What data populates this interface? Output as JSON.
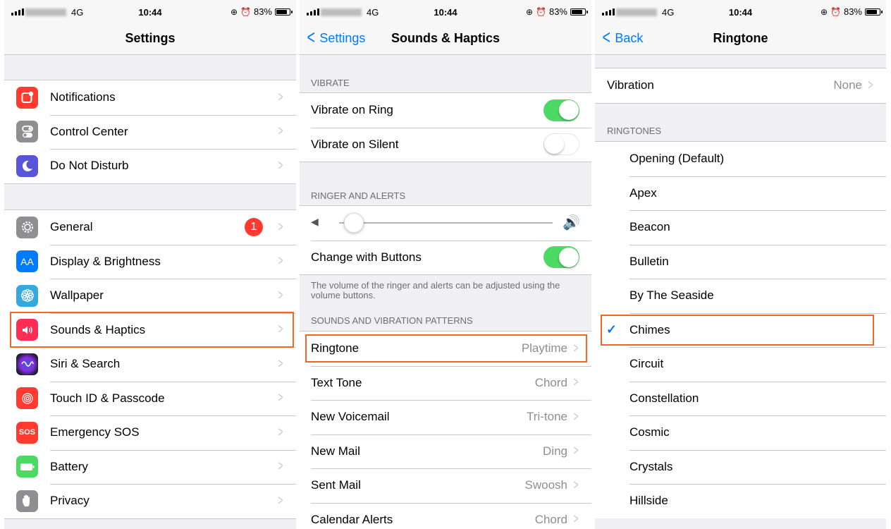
{
  "status": {
    "network": "4G",
    "time": "10:44",
    "battery": "83%",
    "rotation_icon": "rotation-lock-icon",
    "alarm_icon": "alarm-clock-icon"
  },
  "screen1": {
    "title": "Settings",
    "group1": [
      {
        "label": "Notifications",
        "icon": "notifications-icon",
        "color": "#ff3b30"
      },
      {
        "label": "Control Center",
        "icon": "control-center-icon",
        "color": "#8e8e93"
      },
      {
        "label": "Do Not Disturb",
        "icon": "moon-icon",
        "color": "#5856d6"
      }
    ],
    "group2": [
      {
        "label": "General",
        "icon": "gear-icon",
        "color": "#8e8e93",
        "badge": "1"
      },
      {
        "label": "Display & Brightness",
        "icon": "display-icon",
        "color": "#007aff",
        "glyph": "AA"
      },
      {
        "label": "Wallpaper",
        "icon": "wallpaper-icon",
        "color": "#34aadc"
      },
      {
        "label": "Sounds & Haptics",
        "icon": "speaker-icon",
        "color": "#ff2d55"
      },
      {
        "label": "Siri & Search",
        "icon": "siri-icon",
        "color": "#1f1f3a"
      },
      {
        "label": "Touch ID & Passcode",
        "icon": "fingerprint-icon",
        "color": "#ff3b30"
      },
      {
        "label": "Emergency SOS",
        "icon": "sos-icon",
        "color": "#ff3b30",
        "glyph": "SOS"
      },
      {
        "label": "Battery",
        "icon": "battery-icon",
        "color": "#4cd964"
      },
      {
        "label": "Privacy",
        "icon": "hand-icon",
        "color": "#8e8e93"
      }
    ]
  },
  "screen2": {
    "back": "Settings",
    "title": "Sounds & Haptics",
    "vibrate_header": "VIBRATE",
    "vibrate_on_ring": {
      "label": "Vibrate on Ring",
      "on": true
    },
    "vibrate_on_silent": {
      "label": "Vibrate on Silent",
      "on": false
    },
    "ringer_header": "RINGER AND ALERTS",
    "ringer_volume": 0.07,
    "change_with_buttons": {
      "label": "Change with Buttons",
      "on": true
    },
    "ringer_note": "The volume of the ringer and alerts can be adjusted using the volume buttons.",
    "patterns_header": "SOUNDS AND VIBRATION PATTERNS",
    "patterns": [
      {
        "label": "Ringtone",
        "value": "Playtime"
      },
      {
        "label": "Text Tone",
        "value": "Chord"
      },
      {
        "label": "New Voicemail",
        "value": "Tri-tone"
      },
      {
        "label": "New Mail",
        "value": "Ding"
      },
      {
        "label": "Sent Mail",
        "value": "Swoosh"
      },
      {
        "label": "Calendar Alerts",
        "value": "Chord"
      }
    ]
  },
  "screen3": {
    "back": "Back",
    "title": "Ringtone",
    "vibration": {
      "label": "Vibration",
      "value": "None"
    },
    "ringtones_header": "RINGTONES",
    "ringtones": [
      "Opening (Default)",
      "Apex",
      "Beacon",
      "Bulletin",
      "By The Seaside",
      "Chimes",
      "Circuit",
      "Constellation",
      "Cosmic",
      "Crystals",
      "Hillside"
    ],
    "selected": "Chimes"
  },
  "accent": "#007aff",
  "highlight_color": "#f26522"
}
